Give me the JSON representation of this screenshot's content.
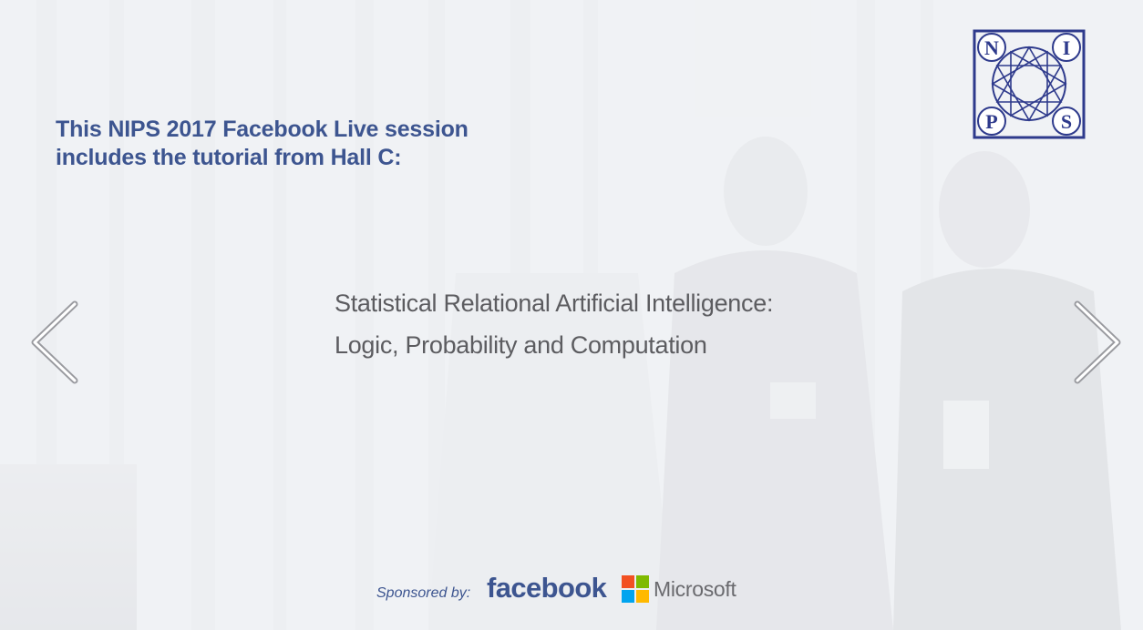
{
  "intro": {
    "line1": "This NIPS 2017 Facebook Live session",
    "line2": "includes the tutorial from Hall C:"
  },
  "tutorial": {
    "line1": "Statistical Relational Artificial Intelligence:",
    "line2": "Logic, Probability and Computation"
  },
  "logo": {
    "letters": [
      "N",
      "I",
      "P",
      "S"
    ],
    "color": "#2e3a8c"
  },
  "sponsors": {
    "label": "Sponsored by:",
    "facebook": "facebook",
    "microsoft": "Microsoft"
  },
  "nav": {
    "prev_icon": "chevron-left-icon",
    "next_icon": "chevron-right-icon"
  },
  "colors": {
    "heading": "#3d5590",
    "tutorial_text": "#5c5c60",
    "ms_red": "#f25022",
    "ms_green": "#7fba00",
    "ms_blue": "#00a4ef",
    "ms_yellow": "#ffb900"
  }
}
